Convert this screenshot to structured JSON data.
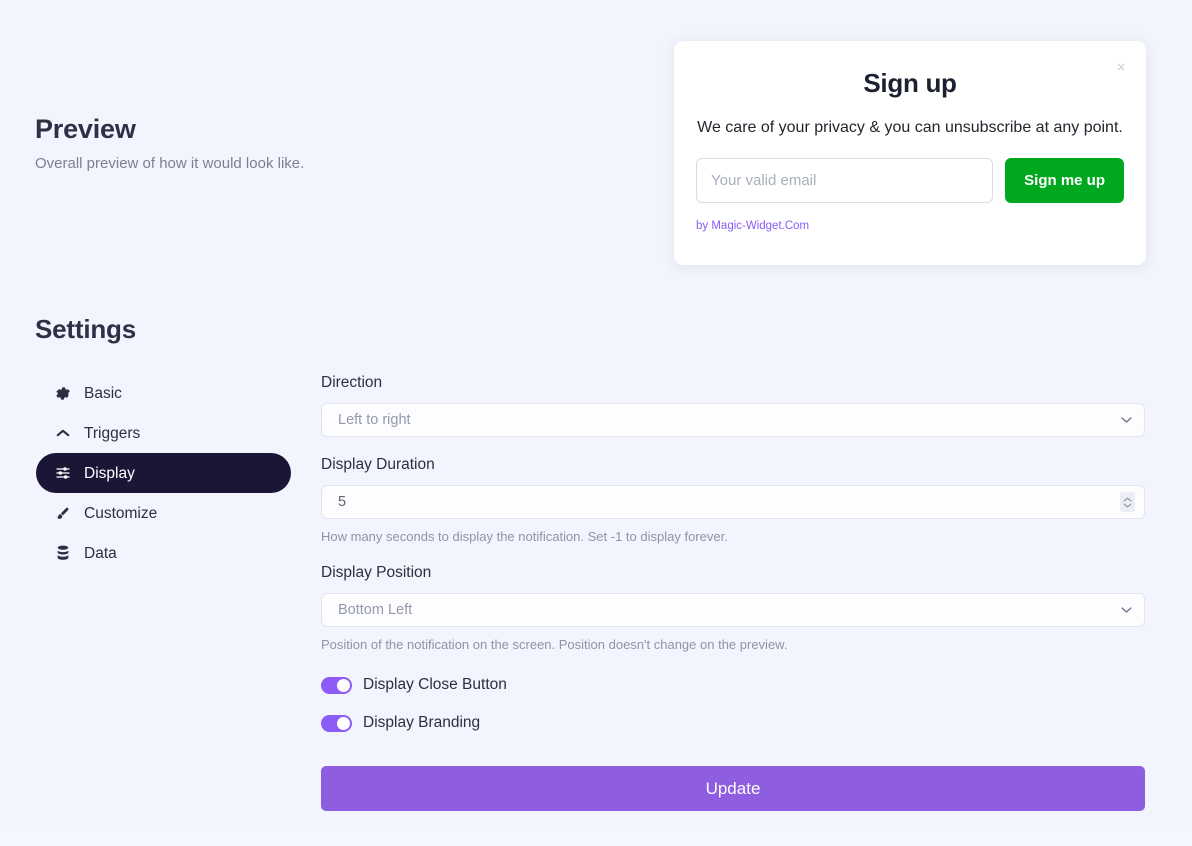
{
  "preview": {
    "title": "Preview",
    "subtitle": "Overall preview of how it would look like."
  },
  "signup_widget": {
    "close_label": "×",
    "title": "Sign up",
    "description": "We care of your privacy & you can unsubscribe at any point.",
    "email_placeholder": "Your valid email",
    "email_value": "",
    "submit_label": "Sign me up",
    "branding": "by Magic-Widget.Com",
    "button_color": "#00a81f",
    "branding_color": "#8b5cf6"
  },
  "settings": {
    "title": "Settings",
    "sidebar": {
      "items": [
        {
          "label": "Basic",
          "icon": "gear-icon",
          "active": false
        },
        {
          "label": "Triggers",
          "icon": "chevron-up-icon",
          "active": false
        },
        {
          "label": "Display",
          "icon": "sliders-icon",
          "active": true
        },
        {
          "label": "Customize",
          "icon": "paintbrush-icon",
          "active": false
        },
        {
          "label": "Data",
          "icon": "database-icon",
          "active": false
        }
      ],
      "active_background": "#1b1636"
    },
    "fields": {
      "direction": {
        "label": "Direction",
        "value": "Left to right"
      },
      "display_duration": {
        "label": "Display Duration",
        "value": "5",
        "help": "How many seconds to display the notification. Set -1 to display forever."
      },
      "display_position": {
        "label": "Display Position",
        "value": "Bottom Left",
        "help": "Position of the notification on the screen. Position doesn't change on the preview."
      },
      "display_close_button": {
        "label": "Display Close Button",
        "enabled": true
      },
      "display_branding": {
        "label": "Display Branding",
        "enabled": true
      }
    },
    "update_label": "Update",
    "accent_color": "#8f5ee0",
    "toggle_color": "#8b5cf6"
  }
}
